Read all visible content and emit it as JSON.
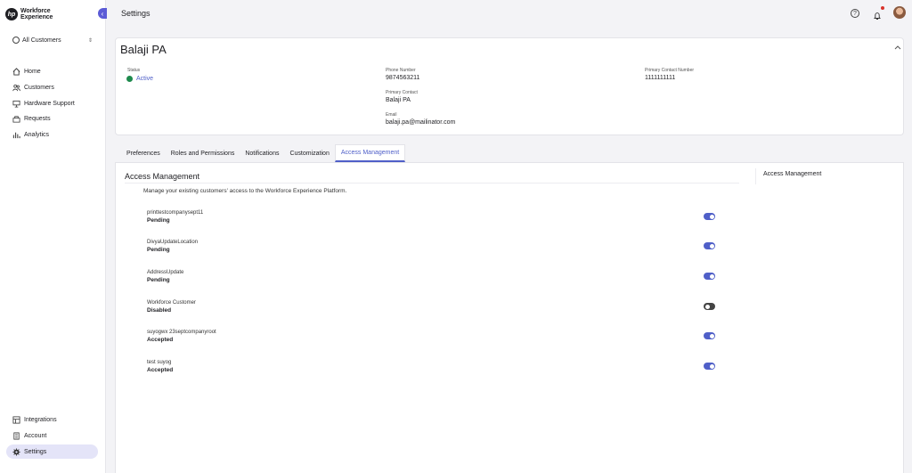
{
  "brand": {
    "line1": "Workforce",
    "line2": "Experience",
    "mark": "hp"
  },
  "tenant": {
    "label": "All Customers"
  },
  "nav": {
    "items": [
      {
        "label": "Home",
        "icon": "home-icon"
      },
      {
        "label": "Customers",
        "icon": "customers-icon"
      },
      {
        "label": "Hardware Support",
        "icon": "hardware-support-icon"
      },
      {
        "label": "Requests",
        "icon": "requests-icon"
      },
      {
        "label": "Analytics",
        "icon": "analytics-icon"
      }
    ],
    "bottom": [
      {
        "label": "Integrations",
        "icon": "integrations-icon"
      },
      {
        "label": "Account",
        "icon": "account-icon"
      },
      {
        "label": "Settings",
        "icon": "gear-icon",
        "active": true
      }
    ]
  },
  "header": {
    "title": "Settings"
  },
  "customer": {
    "name": "Balaji PA",
    "status_label": "Status",
    "status_value": "Active",
    "phone_label": "Phone Number",
    "phone_value": "9874563211",
    "primary_contact_label": "Primary Contact",
    "primary_contact_value": "Balaji PA",
    "email_label": "Email",
    "email_value": "balaji.pa@mailinator.com",
    "primary_contact_number_label": "Primary Contact Number",
    "primary_contact_number_value": "1111111111"
  },
  "tabs": [
    {
      "label": "Preferences"
    },
    {
      "label": "Roles and Permissions"
    },
    {
      "label": "Notifications"
    },
    {
      "label": "Customization"
    },
    {
      "label": "Access Management",
      "active": true
    }
  ],
  "access": {
    "title": "Access Management",
    "description": "Manage your existing customers' access to the Workforce Experience Platform.",
    "side_title": "Access Management",
    "rows": [
      {
        "name": "printtestcompanysept11",
        "status": "Pending",
        "enabled": true
      },
      {
        "name": "DivyaUpdateLocation",
        "status": "Pending",
        "enabled": true
      },
      {
        "name": "AddressUpdate",
        "status": "Pending",
        "enabled": true
      },
      {
        "name": "Workforce Customer",
        "status": "Disabled",
        "enabled": false
      },
      {
        "name": "suyogwx 23septcompanyroot",
        "status": "Accepted",
        "enabled": true
      },
      {
        "name": "test suyog",
        "status": "Accepted",
        "enabled": true
      }
    ]
  },
  "colors": {
    "accent": "#4f5fc8",
    "active_status": "#1e8a4d",
    "toggle_off": "#444444",
    "nav_active_bg": "#e4e4f8"
  }
}
